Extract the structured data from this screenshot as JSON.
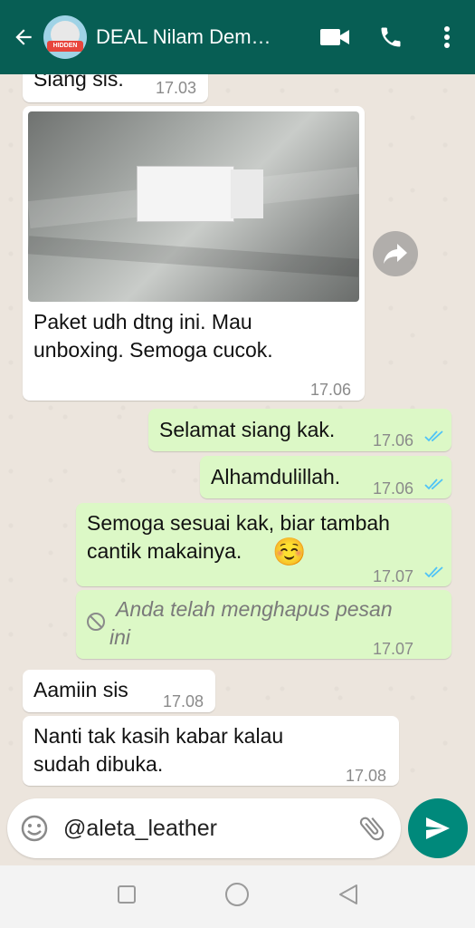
{
  "header": {
    "title": "DEAL Nilam Dem…",
    "avatar_text": "HIDDEN"
  },
  "messages": [
    {
      "text": "Siang sis.",
      "time": "17.03"
    },
    {
      "caption": "Paket udh dtng ini. Mau unboxing. Semoga cucok.",
      "time": "17.06"
    },
    {
      "text": "Selamat siang kak.",
      "time": "17.06"
    },
    {
      "text": "Alhamdulillah.",
      "time": "17.06"
    },
    {
      "text": "Semoga sesuai kak, biar tambah cantik makainya.",
      "emoji": "☺️",
      "time": "17.07"
    },
    {
      "text": "Anda telah menghapus pesan ini",
      "time": "17.07"
    },
    {
      "text": "Aamiin sis",
      "time": "17.08"
    },
    {
      "text": "Nanti tak kasih kabar kalau sudah dibuka.",
      "time": "17.08"
    }
  ],
  "composer": {
    "value": "@aleta_leather"
  },
  "colors": {
    "appbar": "#075e54",
    "outgoing": "#dcf8c6",
    "incoming": "#ffffff",
    "send": "#00897b",
    "read_ticks": "#4fc3f7"
  }
}
